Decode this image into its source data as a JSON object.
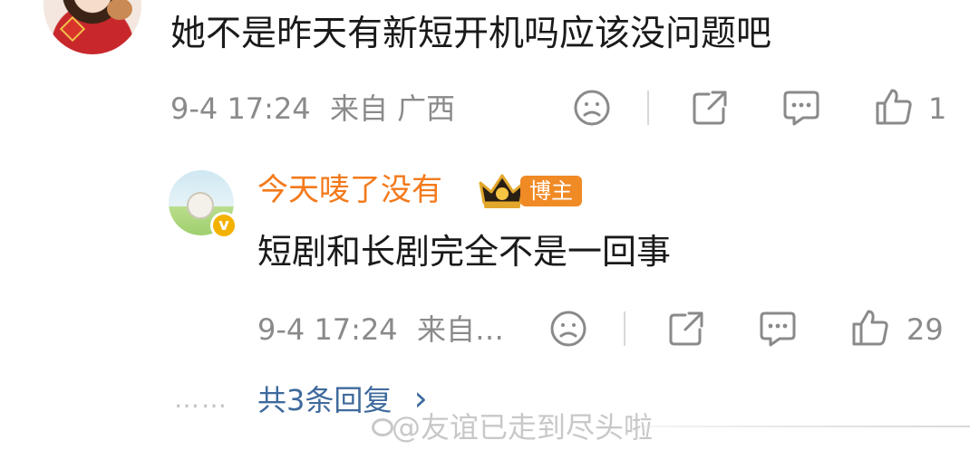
{
  "top_comment": {
    "text": "她不是昨天有新短开机吗应该没问题吧",
    "time": "9-4 17:24",
    "location": "来自 广西",
    "like_count": "1",
    "icons": [
      "emoji-icon",
      "share-icon",
      "comment-icon",
      "like-icon"
    ]
  },
  "reply": {
    "username": "今天唛了没有",
    "badge": "博主",
    "verify_mark": "v",
    "text": "短剧和长剧完全不是一回事",
    "time": "9-4 17:24",
    "location": "来自…",
    "like_count": "29",
    "icons": [
      "emoji-icon",
      "share-icon",
      "comment-icon",
      "like-icon"
    ]
  },
  "more_replies": {
    "dots": "……",
    "label": "共3条回复",
    "chevron": "›"
  },
  "watermark": "@友谊已走到尽头啦",
  "colors": {
    "username": "#f37a1c",
    "badge_bg": "#f08a25",
    "link": "#3f6a9c",
    "meta": "#8a8a8a"
  }
}
